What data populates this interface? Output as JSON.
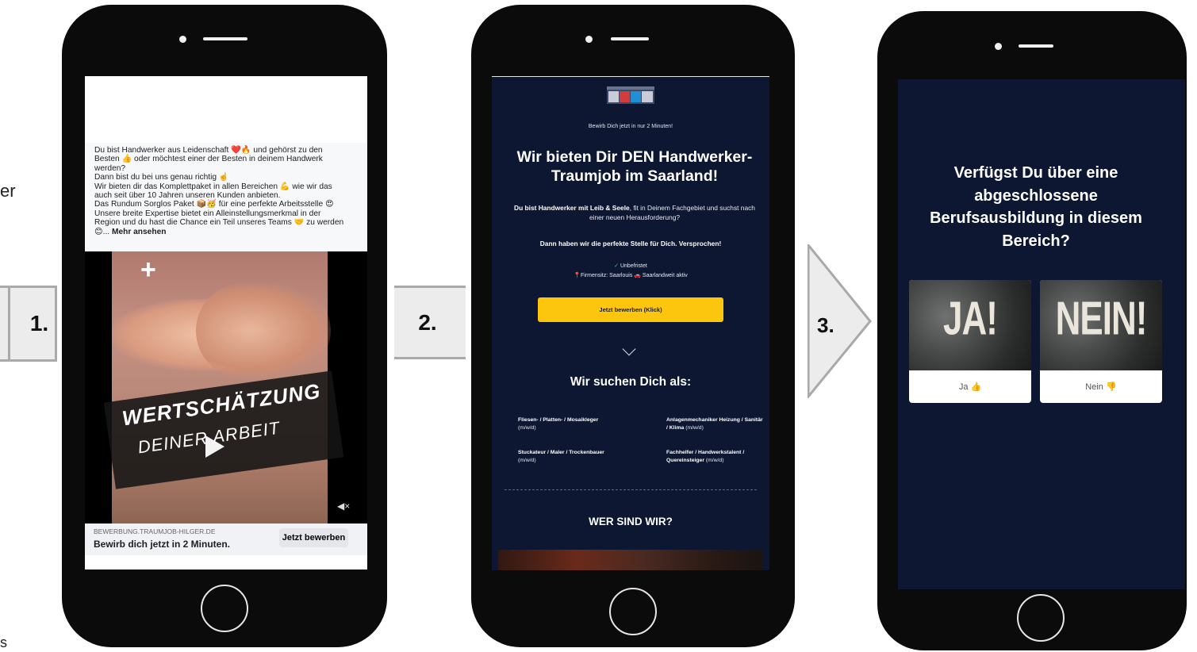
{
  "edge_fragments": {
    "left_mid": "er",
    "left_bottom": "s"
  },
  "steps": {
    "one": "1.",
    "two": "2.",
    "three": "3."
  },
  "ad": {
    "lines": [
      "Du bist Handwerker aus Leidenschaft ❤️🔥 und gehörst zu den",
      "Besten 👍 oder möchtest einer der Besten in deinem Handwerk",
      "werden?",
      "Dann bist du bei uns genau richtig ☝️",
      "Wir bieten dir das Komplettpaket in allen Bereichen 💪 wie wir das",
      "auch seit über 10 Jahren unseren Kunden anbieten.",
      "Das Rundum Sorglos Paket 📦🥳 für eine perfekte Arbeitsstelle 😍",
      "Unsere breite Expertise bietet ein Alleinstellungsmerkmal in der",
      "Region und du hast die Chance ein Teil unseres Teams 🤝 zu werden",
      "😊... "
    ],
    "more_label": "Mehr ansehen",
    "video_line1": "WERTSCHÄTZUNG",
    "video_line2": "DEINER ARBEIT",
    "domain": "BEWERBUNG.TRAUMJOB-HILGER.DE",
    "headline": "Bewirb dich jetzt in 2 Minuten.",
    "cta_label": "Jetzt bewerben"
  },
  "landing": {
    "small_note": "Bewirb Dich jetzt in nur 2 Minuten!",
    "title": "Wir bieten Dir DEN Handwerker-Traumjob im Saarland!",
    "intro_bold": "Du bist Handwerker mit Leib & Seele",
    "intro_rest": ", fit in Deinem Fachgebiet und suchst nach einer neuen Herausforderung?",
    "promise": "Dann haben wir die perfekte Stelle für Dich. Versprochen!",
    "feature1": "Unbefristet",
    "feature2": "Firmensitz: Saarlouis 🚗 Saarlandweit aktiv",
    "button": "Jetzt bewerben (Klick)",
    "section_title": "Wir suchen Dich als:",
    "jobs": [
      {
        "bold": "Fliesen- / Platten- / Mosaikleger",
        "rest": "(m/w/d)"
      },
      {
        "bold": "Anlagenmechaniker Heizung / Sanitär / Klima",
        "rest": "(m/w/d)"
      },
      {
        "bold": "Stuckateur / Maler / Trockenbauer",
        "rest": "(m/w/d)"
      },
      {
        "bold": "Fachhelfer / Handwerkstalent / Quereinsteiger",
        "rest": "(m/w/d)"
      }
    ],
    "who_title": "WER SIND WIR?"
  },
  "quiz": {
    "question": "Verfügst Du über eine abgeschlossene Berufsausbildung in diesem Bereich?",
    "options": [
      {
        "image_text": "JA!",
        "label": "Ja 👍"
      },
      {
        "image_text": "NEIN!",
        "label": "Nein 👎"
      }
    ]
  },
  "colors": {
    "landing_bg": "#0d1732",
    "cta_yellow": "#fbc60d",
    "phone_body": "#0b0b0b"
  }
}
